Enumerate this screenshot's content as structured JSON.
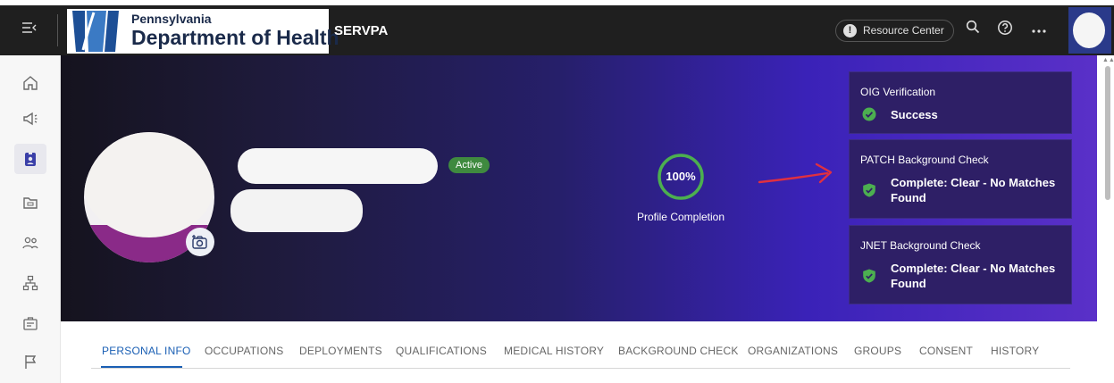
{
  "header": {
    "org_line1": "Pennsylvania",
    "org_line2": "Department of Health",
    "app_name": "SERVPA",
    "resource_center_label": "Resource Center",
    "icons": [
      "menu-collapse-icon",
      "alert-icon",
      "search-icon",
      "help-icon",
      "more-icon"
    ]
  },
  "sidebar": {
    "items": [
      {
        "name": "home-icon",
        "active": false
      },
      {
        "name": "megaphone-icon",
        "active": false
      },
      {
        "name": "profile-badge-icon",
        "active": true
      },
      {
        "name": "folder-icon",
        "active": false
      },
      {
        "name": "people-icon",
        "active": false
      },
      {
        "name": "org-chart-icon",
        "active": false
      },
      {
        "name": "briefcase-icon",
        "active": false
      },
      {
        "name": "flag-icon",
        "active": false
      }
    ]
  },
  "profile": {
    "status_badge": "Active",
    "completion": {
      "percent": 100,
      "label_text": "100%",
      "caption": "Profile Completion"
    }
  },
  "checks": [
    {
      "title": "OIG Verification",
      "status": "Success",
      "icon": "check-circle-icon"
    },
    {
      "title": "PATCH Background Check",
      "status": "Complete: Clear - No Matches Found",
      "icon": "shield-check-icon"
    },
    {
      "title": "JNET Background Check",
      "status": "Complete: Clear - No Matches Found",
      "icon": "shield-check-icon"
    }
  ],
  "tabs": [
    {
      "label": "PERSONAL INFO",
      "active": true
    },
    {
      "label": "OCCUPATIONS",
      "active": false
    },
    {
      "label": "DEPLOYMENTS",
      "active": false
    },
    {
      "label": "QUALIFICATIONS",
      "active": false
    },
    {
      "label": "MEDICAL HISTORY",
      "active": false
    },
    {
      "label": "BACKGROUND CHECK",
      "active": false
    },
    {
      "label": "ORGANIZATIONS",
      "active": false
    },
    {
      "label": "GROUPS",
      "active": false
    },
    {
      "label": "CONSENT",
      "active": false
    },
    {
      "label": "HISTORY",
      "active": false
    }
  ],
  "colors": {
    "topbar": "#1f1f1f",
    "banner_start": "#15131e",
    "banner_end": "#5a30c8",
    "card_bg": "#2e1f66",
    "success_green": "#4caf50",
    "active_badge": "#3f8a3f",
    "tab_active": "#1a5fb4",
    "annotation_arrow": "#e03040"
  }
}
